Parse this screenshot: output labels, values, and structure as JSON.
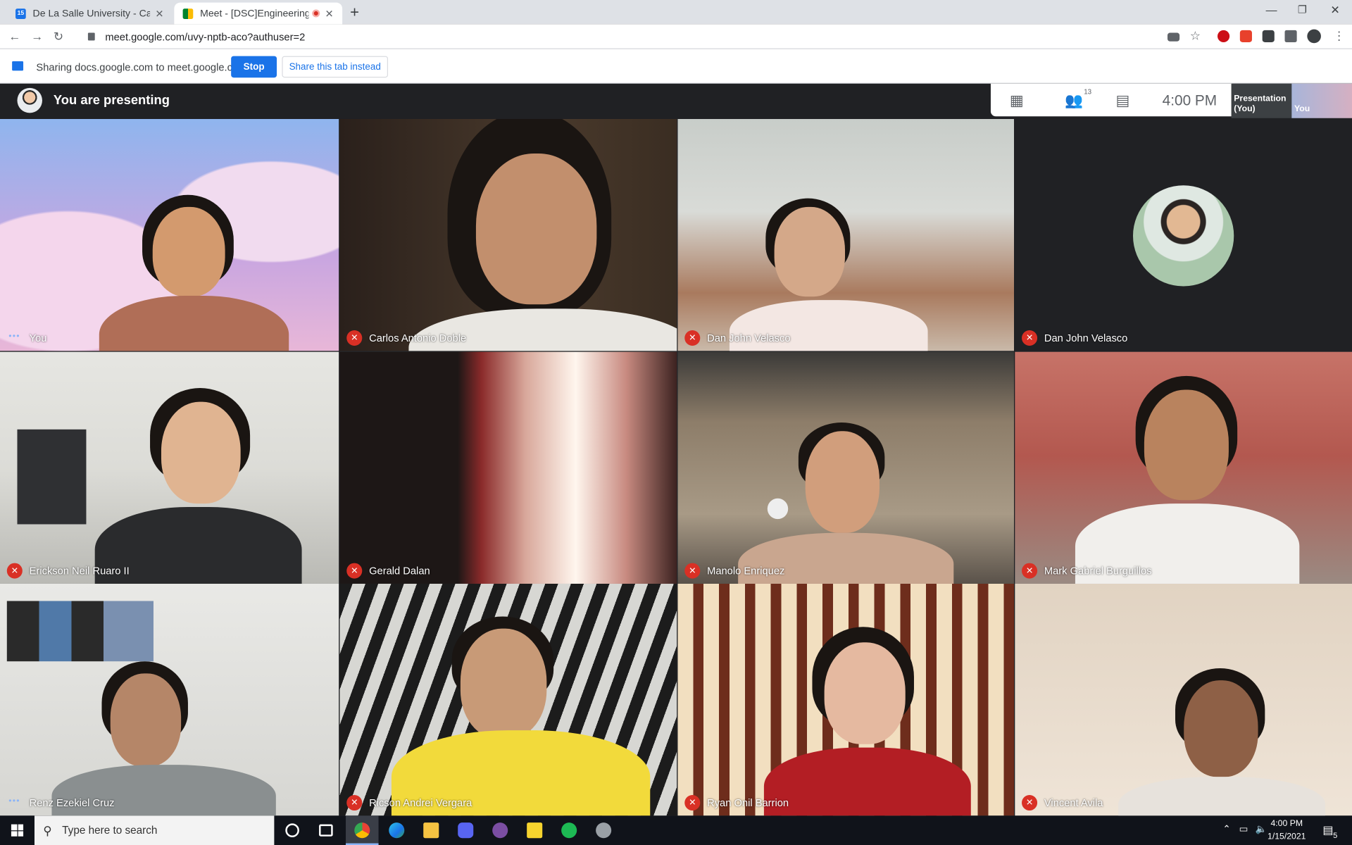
{
  "browser": {
    "tabs": [
      {
        "label": "De La Salle University - Calendar",
        "favicon": "calendar-icon",
        "active": false
      },
      {
        "label": "Meet - [DSC]Engineering Office",
        "favicon": "meet-icon",
        "active": true
      }
    ],
    "new_tab": "+",
    "url": "meet.google.com/uvy-nptb-aco?authuser=2"
  },
  "share_bar": {
    "text": "Sharing docs.google.com to meet.google.com",
    "stop_label": "Stop",
    "share_tab_label": "Share this tab instead"
  },
  "meet": {
    "presenting_text": "You are presenting",
    "participant_count": "13",
    "time": "4:00 PM",
    "thumb_presentation": "Presentation (You)",
    "thumb_you": "You",
    "participants": [
      {
        "name": "You",
        "muted": false
      },
      {
        "name": "Carlos Antonio Doble",
        "muted": true
      },
      {
        "name": "Dan John Velasco",
        "muted": true
      },
      {
        "name": "Dan John Velasco",
        "muted": true
      },
      {
        "name": "Erickson Neil Ruaro II",
        "muted": true
      },
      {
        "name": "Gerald Dalan",
        "muted": true
      },
      {
        "name": "Manolo Enriquez",
        "muted": true
      },
      {
        "name": "Mark Gabriel Burguillos",
        "muted": true
      },
      {
        "name": "Renz Ezekiel Cruz",
        "muted": false
      },
      {
        "name": "Ricson Andrei Vergara",
        "muted": true
      },
      {
        "name": "Ryan Onil Barrion",
        "muted": true
      },
      {
        "name": "Vincent Avila",
        "muted": true
      }
    ]
  },
  "taskbar": {
    "search_placeholder": "Type here to search",
    "time": "4:00 PM",
    "date": "1/15/2021",
    "notifications": "5"
  },
  "colors": {
    "accent": "#1a73e8",
    "muted_red": "#d93025",
    "meet_bg": "#202124"
  }
}
